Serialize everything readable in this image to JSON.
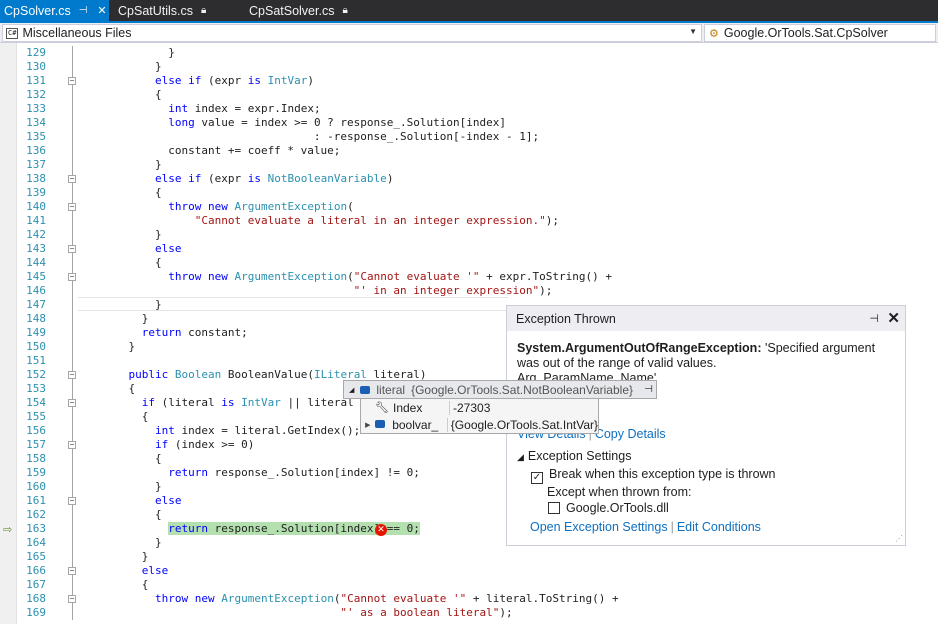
{
  "tabs": [
    {
      "label": "CpSolver.cs",
      "active": true,
      "pinned": true
    },
    {
      "label": "CpSatUtils.cs",
      "active": false,
      "pinned": false
    },
    {
      "label": "CpSatSolver.cs",
      "active": false,
      "pinned": false
    }
  ],
  "navbar": {
    "project": "Miscellaneous Files",
    "badge": "C#",
    "member": "Google.OrTools.Sat.CpSolver"
  },
  "lines": [
    {
      "n": "129",
      "t": "          }"
    },
    {
      "n": "130",
      "t": "        }"
    },
    {
      "n": "131",
      "t": "        else if (expr is IntVar)"
    },
    {
      "n": "132",
      "t": "        {"
    },
    {
      "n": "133",
      "t": "          int index = expr.Index;"
    },
    {
      "n": "134",
      "t": "          long value = index >= 0 ? response_.Solution[index]"
    },
    {
      "n": "135",
      "t": "                                : -response_.Solution[-index - 1];"
    },
    {
      "n": "136",
      "t": "          constant += coeff * value;"
    },
    {
      "n": "137",
      "t": "        }"
    },
    {
      "n": "138",
      "t": "        else if (expr is NotBooleanVariable)"
    },
    {
      "n": "139",
      "t": "        {"
    },
    {
      "n": "140",
      "t": "          throw new ArgumentException("
    },
    {
      "n": "141",
      "t": "              \"Cannot evaluate a literal in an integer expression.\");"
    },
    {
      "n": "142",
      "t": "        }"
    },
    {
      "n": "143",
      "t": "        else"
    },
    {
      "n": "144",
      "t": "        {"
    },
    {
      "n": "145",
      "t": "          throw new ArgumentException(\"Cannot evaluate '\" + expr.ToString() +"
    },
    {
      "n": "146",
      "t": "                                      \"' in an integer expression\");"
    },
    {
      "n": "147",
      "t": "        }"
    },
    {
      "n": "148",
      "t": "      }"
    },
    {
      "n": "149",
      "t": "      return constant;"
    },
    {
      "n": "150",
      "t": "    }"
    },
    {
      "n": "151",
      "t": ""
    },
    {
      "n": "152",
      "t": "    public Boolean BooleanValue(ILiteral literal)"
    },
    {
      "n": "153",
      "t": "    {"
    },
    {
      "n": "154",
      "t": "      if (literal is IntVar || literal is NotBoo"
    },
    {
      "n": "155",
      "t": "      {"
    },
    {
      "n": "156",
      "t": "        int index = literal.GetIndex();"
    },
    {
      "n": "157",
      "t": "        if (index >= 0)"
    },
    {
      "n": "158",
      "t": "        {"
    },
    {
      "n": "159",
      "t": "          return response_.Solution[index] != 0;"
    },
    {
      "n": "160",
      "t": "        }"
    },
    {
      "n": "161",
      "t": "        else"
    },
    {
      "n": "162",
      "t": "        {"
    },
    {
      "n": "163",
      "t": "          return response_.Solution[index] == 0;"
    },
    {
      "n": "164",
      "t": "        }"
    },
    {
      "n": "165",
      "t": "      }"
    },
    {
      "n": "166",
      "t": "      else"
    },
    {
      "n": "167",
      "t": "      {"
    },
    {
      "n": "168",
      "t": "        throw new ArgumentException(\"Cannot evaluate '\" + literal.ToString() +"
    },
    {
      "n": "169",
      "t": "                                    \"' as a boolean literal\");"
    }
  ],
  "keywords": [
    "else",
    "if",
    "is",
    "int",
    "long",
    "throw",
    "new",
    "return",
    "public"
  ],
  "types": [
    "IntVar",
    "ArgumentException",
    "Boolean",
    "NotBooleanVariable",
    "ILiteral"
  ],
  "exception": {
    "title": "Exception Thrown",
    "type": "System.ArgumentOutOfRangeException:",
    "message": "'Specified argument was out of the range of valid values.",
    "message_tail": "Arg_ParamName_Name'",
    "view_details": "View Details",
    "copy_details": "Copy Details",
    "settings_header": "Exception Settings",
    "break_label": "Break when this exception type is thrown",
    "break_checked": true,
    "except_label": "Except when thrown from:",
    "dll_label": "Google.OrTools.dll",
    "dll_checked": false,
    "open_settings": "Open Exception Settings",
    "edit_conditions": "Edit Conditions"
  },
  "datatip": {
    "name": "literal",
    "value": "{Google.OrTools.Sat.NotBooleanVariable}",
    "children": [
      {
        "name": "Index",
        "value": "-27303",
        "icon": "wrench-icon"
      },
      {
        "name": "boolvar_",
        "value": "{Google.OrTools.Sat.IntVar}",
        "icon": "field-icon"
      }
    ]
  },
  "colors": {
    "accent": "#007acc",
    "keyword": "#0000ff",
    "type": "#2b91af",
    "string": "#a31515",
    "highlight": "#b4e0b0",
    "error": "#e51400",
    "link": "#0e70c0"
  }
}
